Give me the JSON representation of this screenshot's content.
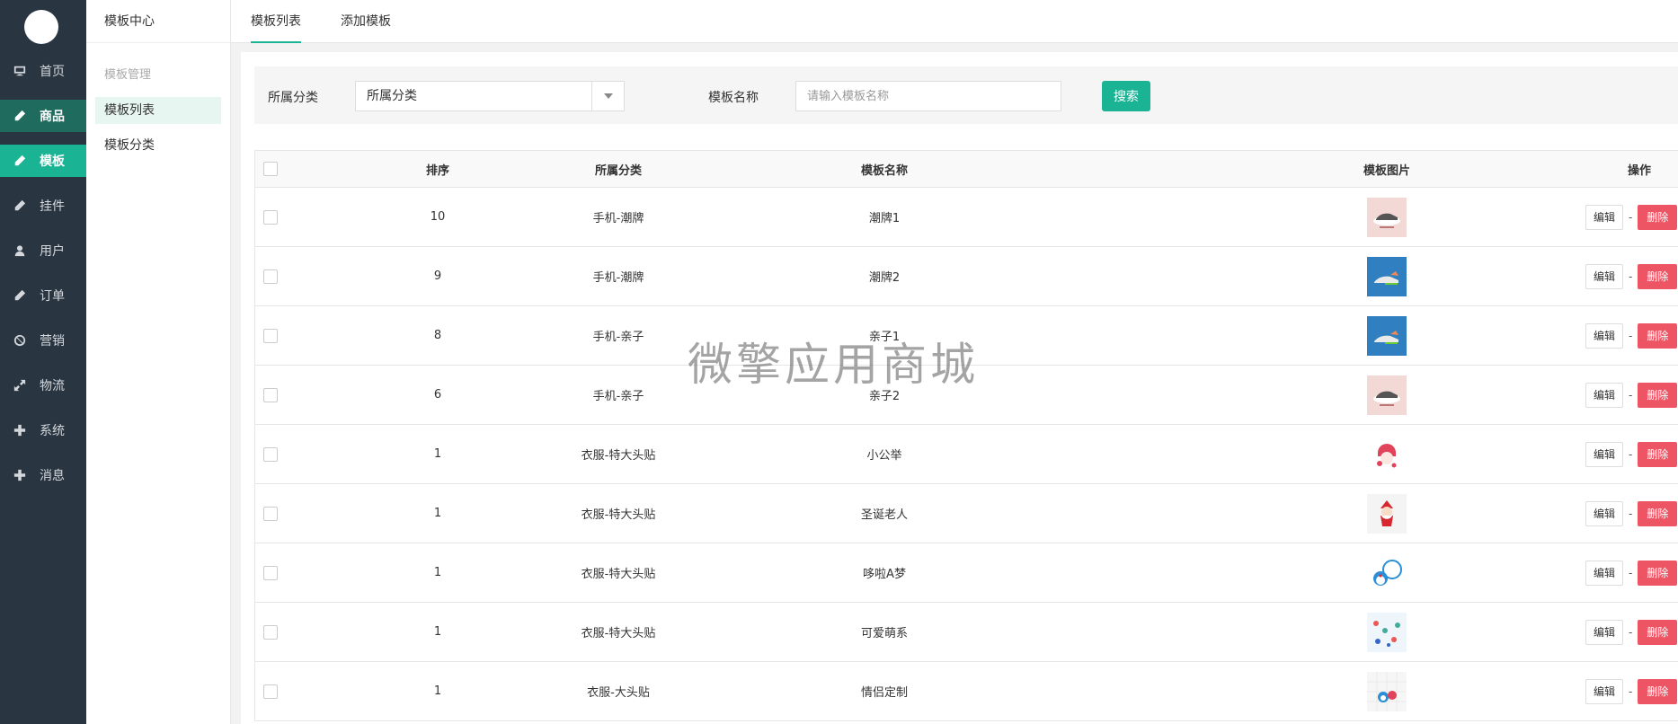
{
  "nav": {
    "items": [
      {
        "label": "首页",
        "icon": "monitor-icon"
      },
      {
        "label": "商品",
        "icon": "pencil-icon"
      },
      {
        "label": "模板",
        "icon": "pencil-icon"
      },
      {
        "label": "挂件",
        "icon": "pencil-icon"
      },
      {
        "label": "用户",
        "icon": "user-icon"
      },
      {
        "label": "订单",
        "icon": "pencil-icon"
      },
      {
        "label": "营销",
        "icon": "ban-icon"
      },
      {
        "label": "物流",
        "icon": "expand-icon"
      },
      {
        "label": "系统",
        "icon": "plus-icon"
      },
      {
        "label": "消息",
        "icon": "plus-icon"
      }
    ]
  },
  "subnav": {
    "title": "模板中心",
    "group": "模板管理",
    "items": [
      "模板列表",
      "模板分类"
    ]
  },
  "tabs": [
    "模板列表",
    "添加模板"
  ],
  "filter": {
    "category_label": "所属分类",
    "category_value": "所属分类",
    "name_label": "模板名称",
    "name_placeholder": "请输入模板名称",
    "search_label": "搜索"
  },
  "table": {
    "headers": {
      "sort": "排序",
      "category": "所属分类",
      "name": "模板名称",
      "image": "模板图片",
      "ops": "操作"
    },
    "edit_label": "编辑",
    "sep": "-",
    "delete_label": "删除",
    "rows": [
      {
        "sort": "10",
        "category": "手机-潮牌",
        "name": "潮牌1",
        "thumb": "shoe-pink"
      },
      {
        "sort": "9",
        "category": "手机-潮牌",
        "name": "潮牌2",
        "thumb": "shoe-blue"
      },
      {
        "sort": "8",
        "category": "手机-亲子",
        "name": "亲子1",
        "thumb": "shoe-blue"
      },
      {
        "sort": "6",
        "category": "手机-亲子",
        "name": "亲子2",
        "thumb": "shoe-pink"
      },
      {
        "sort": "1",
        "category": "衣服-特大头贴",
        "name": "小公举",
        "thumb": "girl"
      },
      {
        "sort": "1",
        "category": "衣服-特大头贴",
        "name": "圣诞老人",
        "thumb": "santa"
      },
      {
        "sort": "1",
        "category": "衣服-特大头贴",
        "name": "哆啦A梦",
        "thumb": "doraemon"
      },
      {
        "sort": "1",
        "category": "衣服-特大头贴",
        "name": "可爱萌系",
        "thumb": "cute"
      },
      {
        "sort": "1",
        "category": "衣服-大头贴",
        "name": "情侣定制",
        "thumb": "couple"
      }
    ]
  },
  "watermark": "微擎应用商城",
  "colors": {
    "accent": "#1ab394",
    "danger": "#ed5565",
    "nav_bg": "#2a3542"
  }
}
